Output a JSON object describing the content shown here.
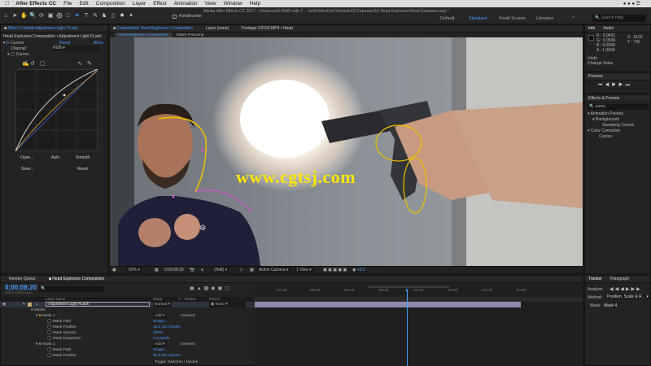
{
  "menubar": {
    "app": "After Effects CC",
    "items": [
      "File",
      "Edit",
      "Composition",
      "Layer",
      "Effect",
      "Animation",
      "View",
      "Window",
      "Help"
    ]
  },
  "title": "Adobe After Effects CC 2017 - /Volumes/G-RAID with T ... bolt/VideoFort/Tutorials/02 February/10 Head Explosion/Head Explosion.aep *",
  "toolbar": {
    "rotobrush": "RotoBrusher",
    "workspaces": [
      "Default",
      "Standard",
      "Small Screen",
      "Libraries"
    ],
    "active_workspace": "Standard",
    "search_placeholder": "Search Help"
  },
  "effect_controls": {
    "tab": "Effect Controls Adjustment Light FLash",
    "header": "Head Explosion Composition • Adjustment Light FLash",
    "effect_name": "Curves",
    "reset": "Reset",
    "about": "Abou",
    "channel_label": "Channel:",
    "channel_value": "RGB",
    "curves_label": "Curves",
    "buttons": [
      "Open...",
      "Auto",
      "Smooth",
      "Save...",
      "Reset"
    ]
  },
  "viewer": {
    "tabs": [
      "Composition Head Explosion Composition",
      "Layer (none)",
      "Footage C0155.MP4 • Head"
    ],
    "subtabs": [
      "Head Explosion Composition",
      "Fabric Precomp"
    ],
    "watermark": "www.cgtsj.com",
    "bottom": {
      "zoom": "50%",
      "time": "0:00:08:20",
      "resolution": "(Half)",
      "camera": "Active Camera",
      "view": "1 View",
      "exposure": "+0.0"
    }
  },
  "info": {
    "tabs": [
      "Info",
      "Audio"
    ],
    "r": "R : 0.0432",
    "g": "G : 0.0506",
    "b": "B : 0.0568",
    "a": "A : 1.0000",
    "x": "X : 3102",
    "y": "Y : 742",
    "undo": "Undo",
    "undo_value": "Change Value"
  },
  "preview": {
    "title": "Preview"
  },
  "effects_presets": {
    "title": "Effects & Presets",
    "search": "curve",
    "tree": [
      "▾ Animation Presets",
      "▾ Backgrounds",
      "Sweeping Curves",
      "▾ Color Correction",
      "Curves"
    ]
  },
  "timeline": {
    "tabs": [
      "Render Queue",
      "Head Explosion Composition"
    ],
    "timecode": "0;00;08;20",
    "fps": "00212 (23.976 fps)",
    "search_placeholder": "",
    "columns": [
      "Layer Name",
      "Mode",
      "T",
      "TrkMat",
      "Parent"
    ],
    "layer": {
      "num": "1",
      "name": "Adjustment Light FLash",
      "mode": "Normal",
      "parent": "None"
    },
    "rows": [
      {
        "label": "Masks",
        "value": ""
      },
      {
        "label": "Mask 1",
        "value": "Add",
        "extra": "Inverted"
      },
      {
        "label": "Mask Path",
        "value": "Shape..."
      },
      {
        "label": "Mask Feather",
        "value": "15.0,15.0 pixels"
      },
      {
        "label": "Mask Opacity",
        "value": "100%"
      },
      {
        "label": "Mask Expansion",
        "value": "0.0 pixels"
      },
      {
        "label": "Mask 2",
        "value": "Add",
        "extra": "Inverted"
      },
      {
        "label": "Mask Path",
        "value": "Shape..."
      },
      {
        "label": "Mask Feather",
        "value": "30.0,30.0 pixels"
      }
    ],
    "ruler": [
      "07:12f",
      "08:00f",
      "08:12f",
      "09:00f",
      "09:12f",
      "10:00f",
      "10:12f",
      "11:00f"
    ],
    "toggle": "Toggle Switches / Modes"
  },
  "tracker": {
    "tabs": [
      "Tracker",
      "Paragraph"
    ],
    "analyze": "Analyze:",
    "method_label": "Method:",
    "method_value": "Position, Scale & R...",
    "mask_label": "Mask:",
    "mask_value": "Mask 4"
  },
  "colors": {
    "accent": "#4a9dff",
    "panel": "#232323",
    "watermark": "#ffe600"
  }
}
